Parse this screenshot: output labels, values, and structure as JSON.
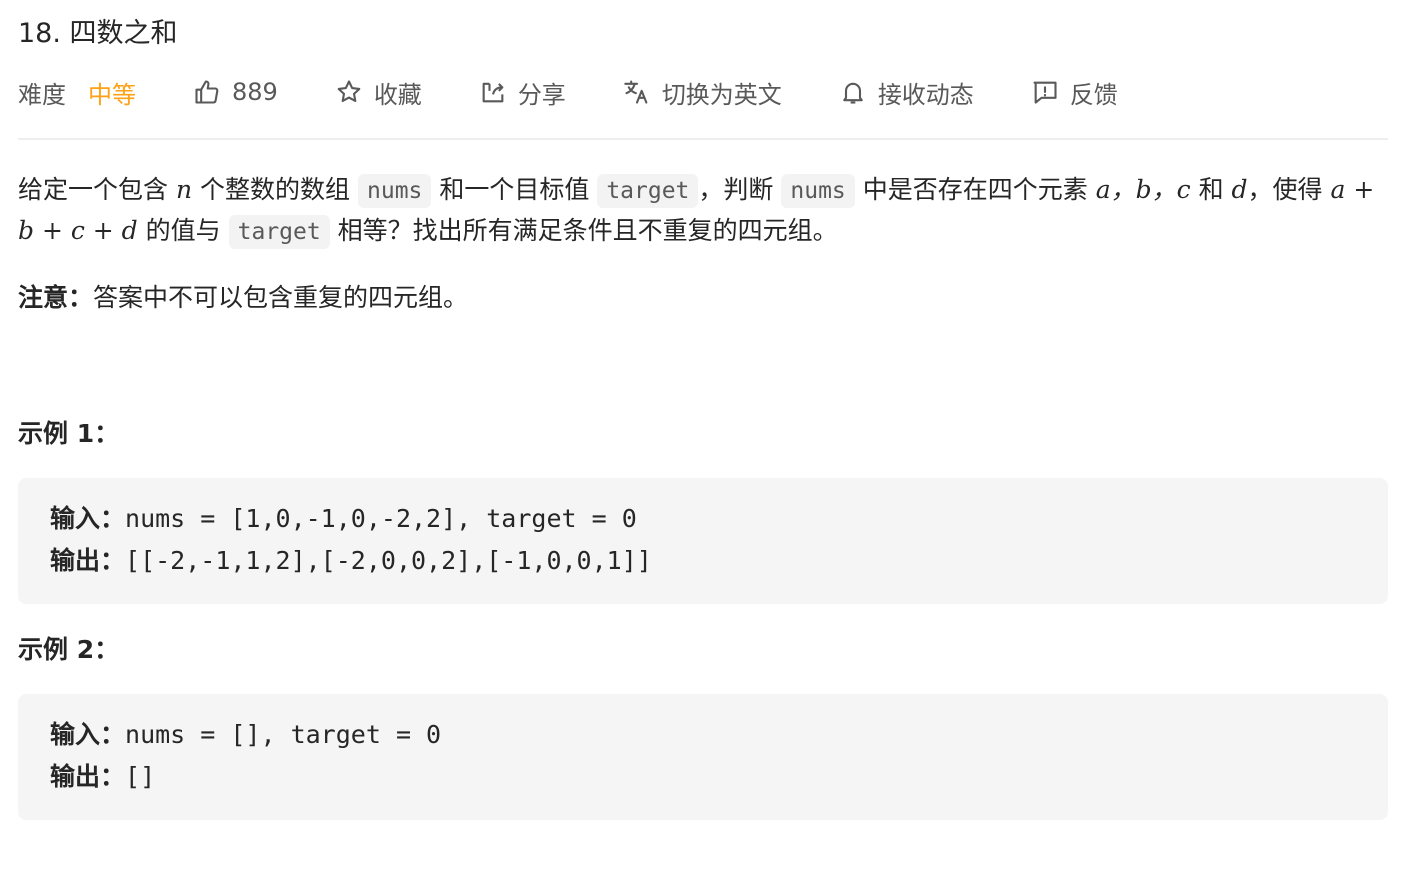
{
  "problem": {
    "title": "18. 四数之和"
  },
  "toolbar": {
    "difficulty_label": "难度",
    "difficulty_value": "中等",
    "difficulty_color": "#ffa116",
    "likes_count": "889",
    "favorite_label": "收藏",
    "share_label": "分享",
    "translate_label": "切换为英文",
    "subscribe_label": "接收动态",
    "feedback_label": "反馈",
    "icons": [
      "thumbs-up-icon",
      "star-icon",
      "share-icon",
      "translate-icon",
      "bell-icon",
      "feedback-icon"
    ]
  },
  "description": {
    "p1": "给定一个包含",
    "v_n": "n",
    "p2": "个整数的数组",
    "c_nums": "nums",
    "p3": "和一个目标值",
    "c_target": "target",
    "p4": "，判断",
    "c_nums2": "nums",
    "p5": "中是否存在四个元素",
    "v_abc": "a，b，c",
    "p6": "和",
    "v_d": "d",
    "p7": "，使得",
    "v_expr": "a + b + c + d",
    "p8": "的值与",
    "c_target2": "target",
    "p9": "相等？找出所有满足条件且不重复的四元组。"
  },
  "note": {
    "label": "注意：",
    "text": "答案中不可以包含重复的四元组。"
  },
  "examples": [
    {
      "title": "示例 1：",
      "input_label": "输入：",
      "input": "nums = [1,0,-1,0,-2,2], target = 0",
      "output_label": "输出：",
      "output": "[[-2,-1,1,2],[-2,0,0,2],[-1,0,0,1]]"
    },
    {
      "title": "示例 2：",
      "input_label": "输入：",
      "input": "nums = [], target = 0",
      "output_label": "输出：",
      "output": "[]"
    }
  ]
}
